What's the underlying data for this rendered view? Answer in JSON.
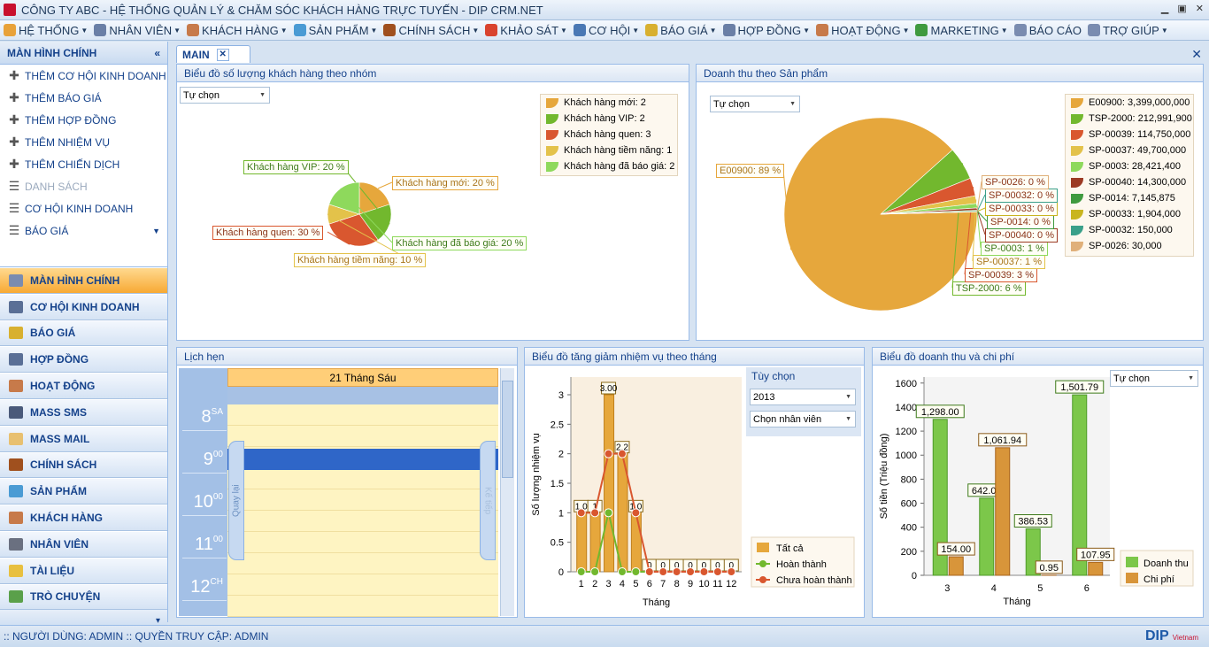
{
  "window": {
    "title": "CÔNG TY ABC - HỆ THỐNG QUẢN LÝ & CHĂM SÓC KHÁCH HÀNG TRỰC TUYẾN - DIP CRM.NET"
  },
  "menu": [
    {
      "label": "HỆ THỐNG",
      "icon": "system-icon",
      "color": "#e8a23a"
    },
    {
      "label": "NHÂN VIÊN",
      "icon": "staff-icon",
      "color": "#6a7fa6"
    },
    {
      "label": "KHÁCH HÀNG",
      "icon": "customers-icon",
      "color": "#c77a4a"
    },
    {
      "label": "SẢN PHẨM",
      "icon": "products-icon",
      "color": "#4a9bd4"
    },
    {
      "label": "CHÍNH SÁCH",
      "icon": "policy-icon",
      "color": "#a0501e"
    },
    {
      "label": "KHẢO SÁT",
      "icon": "survey-icon",
      "color": "#d9432e"
    },
    {
      "label": "CƠ HỘI",
      "icon": "opportunity-icon",
      "color": "#4a78b4"
    },
    {
      "label": "BÁO GIÁ",
      "icon": "quote-icon",
      "color": "#d8b030"
    },
    {
      "label": "HỢP ĐỒNG",
      "icon": "contract-icon",
      "color": "#6a7fa6"
    },
    {
      "label": "HOẠT ĐỘNG",
      "icon": "activity-icon",
      "color": "#c77a4a"
    },
    {
      "label": "MARKETING",
      "icon": "globe-icon",
      "color": "#3f9a3f"
    },
    {
      "label": "BÁO CÁO",
      "icon": "report-icon",
      "color": "#7a8cb0",
      "nodrop": true
    },
    {
      "label": "TRỢ GIÚP",
      "icon": "help-icon",
      "color": "#7a8cb0"
    }
  ],
  "sidebar": {
    "title": "MÀN HÌNH CHÍNH",
    "quick": [
      {
        "label": "THÊM CƠ HỘI KINH DOANH"
      },
      {
        "label": "THÊM BÁO GIÁ"
      },
      {
        "label": "THÊM HỢP ĐỒNG"
      },
      {
        "label": "THÊM NHIỆM VỤ"
      },
      {
        "label": "THÊM CHIẾN DỊCH"
      },
      {
        "label": "DANH SÁCH"
      },
      {
        "label": "CƠ HỘI KINH DOANH"
      },
      {
        "label": "BÁO GIÁ"
      }
    ],
    "nav": [
      {
        "label": "MÀN HÌNH CHÍNH",
        "color": "#7a8cb0"
      },
      {
        "label": "CƠ HỘI KINH DOANH",
        "color": "#5a6f96"
      },
      {
        "label": "BÁO GIÁ",
        "color": "#d8b030"
      },
      {
        "label": "HỢP ĐỒNG",
        "color": "#5a6f96"
      },
      {
        "label": "HOẠT ĐỘNG",
        "color": "#c77a4a"
      },
      {
        "label": "MASS SMS",
        "color": "#4a5a7a"
      },
      {
        "label": "MASS MAIL",
        "color": "#e8c070"
      },
      {
        "label": "CHÍNH SÁCH",
        "color": "#a0501e"
      },
      {
        "label": "SẢN PHẨM",
        "color": "#4a9bd4"
      },
      {
        "label": "KHÁCH HÀNG",
        "color": "#c77a4a"
      },
      {
        "label": "NHÂN VIÊN",
        "color": "#6a7080"
      },
      {
        "label": "TÀI LIỆU",
        "color": "#e8c040"
      },
      {
        "label": "TRÒ CHUYỆN",
        "color": "#5aa04a"
      }
    ]
  },
  "tab": {
    "label": "MAIN"
  },
  "panels": {
    "group": {
      "title": "Biểu đồ số lượng khách hàng theo nhóm",
      "combo": "Tự chọn"
    },
    "revenue": {
      "title": "Doanh thu theo Sản phẩm",
      "combo": "Tự chọn"
    },
    "calendar": {
      "title": "Lịch hẹn",
      "date": "21 Tháng Sáu",
      "back": "Quay lại",
      "next": "Kế tiếp",
      "times": [
        {
          "h": "8",
          "ap": "SA"
        },
        {
          "h": "9",
          "ap": "00"
        },
        {
          "h": "10",
          "ap": "00"
        },
        {
          "h": "11",
          "ap": "00"
        },
        {
          "h": "12",
          "ap": "CH"
        }
      ]
    },
    "tasks": {
      "title": "Biểu đồ tăng giảm nhiệm vụ theo tháng",
      "opt_title": "Tùy chọn",
      "year": "2013",
      "staff": "Chọn nhân viên"
    },
    "revexp": {
      "title": "Biểu đồ doanh thu và chi phí",
      "combo": "Tự chọn"
    }
  },
  "chart_data": [
    {
      "type": "pie",
      "id": "group",
      "legend": [
        "Khách hàng mới: 2",
        "Khách hàng VIP: 2",
        "Khách hàng quen: 3",
        "Khách hàng tiềm năng: 1",
        "Khách hàng đã báo giá: 2"
      ],
      "labels": [
        "Khách hàng mới: 20 %",
        "Khách hàng VIP: 20 %",
        "Khách hàng quen: 30 %",
        "Khách hàng tiềm năng: 10 %",
        "Khách hàng đã báo giá: 20 %"
      ],
      "values": [
        2,
        2,
        3,
        1,
        2
      ],
      "colors": [
        "#e6a73c",
        "#72b82e",
        "#d9572f",
        "#e3c24a",
        "#8ed95c"
      ]
    },
    {
      "type": "pie",
      "id": "revenue",
      "legend": [
        "E00900: 3,399,000,000",
        "TSP-2000: 212,991,900",
        "SP-00039: 114,750,000",
        "SP-00037: 49,700,000",
        "SP-0003: 28,421,400",
        "SP-00040: 14,300,000",
        "SP-0014: 7,145,875",
        "SP-00033: 1,904,000",
        "SP-00032: 150,000",
        "SP-0026: 30,000"
      ],
      "labels": [
        "E00900: 89 %",
        "TSP-2000: 6 %",
        "SP-00039: 3 %",
        "SP-00037: 1 %",
        "SP-0003: 1 %",
        "SP-00040: 0 %",
        "SP-0014: 0 %",
        "SP-00033: 0 %",
        "SP-00032: 0 %",
        "SP-0026: 0 %"
      ],
      "values": [
        3399000000,
        212991900,
        114750000,
        49700000,
        28421400,
        14300000,
        7145875,
        1904000,
        150000,
        30000
      ],
      "colors": [
        "#e6a73c",
        "#72b82e",
        "#d9572f",
        "#e3c24a",
        "#8ed95c",
        "#9c3a24",
        "#3f9a3f",
        "#c9b51f",
        "#3aa08a",
        "#e0b07a"
      ]
    },
    {
      "type": "bar",
      "id": "tasks",
      "xlabel": "Tháng",
      "ylabel": "Số lượng nhiệm vụ",
      "ylim": [
        0,
        3.3
      ],
      "yticks": [
        "0",
        "0.5",
        "1",
        "1.5",
        "2",
        "2.5",
        "3"
      ],
      "categories": [
        "1",
        "2",
        "3",
        "4",
        "5",
        "6",
        "7",
        "8",
        "9",
        "10",
        "11",
        "12"
      ],
      "series": [
        {
          "name": "Tất cả",
          "type": "bar",
          "values": [
            1,
            1,
            3,
            2,
            1,
            0,
            0,
            0,
            0,
            0,
            0,
            0
          ],
          "color": "#e6a73c"
        },
        {
          "name": "Hoàn thành",
          "type": "line",
          "values": [
            0,
            0,
            1,
            0,
            0,
            0,
            0,
            0,
            0,
            0,
            0,
            0
          ],
          "color": "#72b82e"
        },
        {
          "name": "Chưa hoàn thành",
          "type": "line",
          "values": [
            1,
            1,
            2,
            2,
            1,
            0,
            0,
            0,
            0,
            0,
            0,
            0
          ],
          "color": "#d9572f"
        }
      ],
      "bar_labels": [
        "1.0",
        "1",
        "3.00",
        "2.2",
        "1.0",
        "0",
        "0",
        "0",
        "0",
        "0",
        "0",
        "0"
      ]
    },
    {
      "type": "bar",
      "id": "revexp",
      "xlabel": "Tháng",
      "ylabel": "Số tiền (Triệu đồng)",
      "ylim": [
        0,
        1650
      ],
      "yticks": [
        "0",
        "200",
        "400",
        "600",
        "800",
        "1000",
        "1200",
        "1400",
        "1600"
      ],
      "categories": [
        "3",
        "4",
        "5",
        "6"
      ],
      "series": [
        {
          "name": "Doanh thu",
          "values": [
            1298.0,
            642.07,
            386.53,
            1501.79
          ],
          "labels": [
            "1,298.00",
            "642.07",
            "386.53",
            "1,501.79"
          ],
          "color": "#7cc74a"
        },
        {
          "name": "Chi phí",
          "values": [
            154.0,
            1061.94,
            0.95,
            107.95
          ],
          "labels": [
            "154.00",
            "1,061.94",
            "0.95",
            "107.95"
          ],
          "color": "#d8953a"
        }
      ]
    }
  ],
  "status": {
    "text": ":: NGƯỜI DÙNG: ADMIN  :: QUYỀN TRUY CẬP: ADMIN",
    "brand": "DIP",
    "brand_sub": "Vietnam"
  }
}
